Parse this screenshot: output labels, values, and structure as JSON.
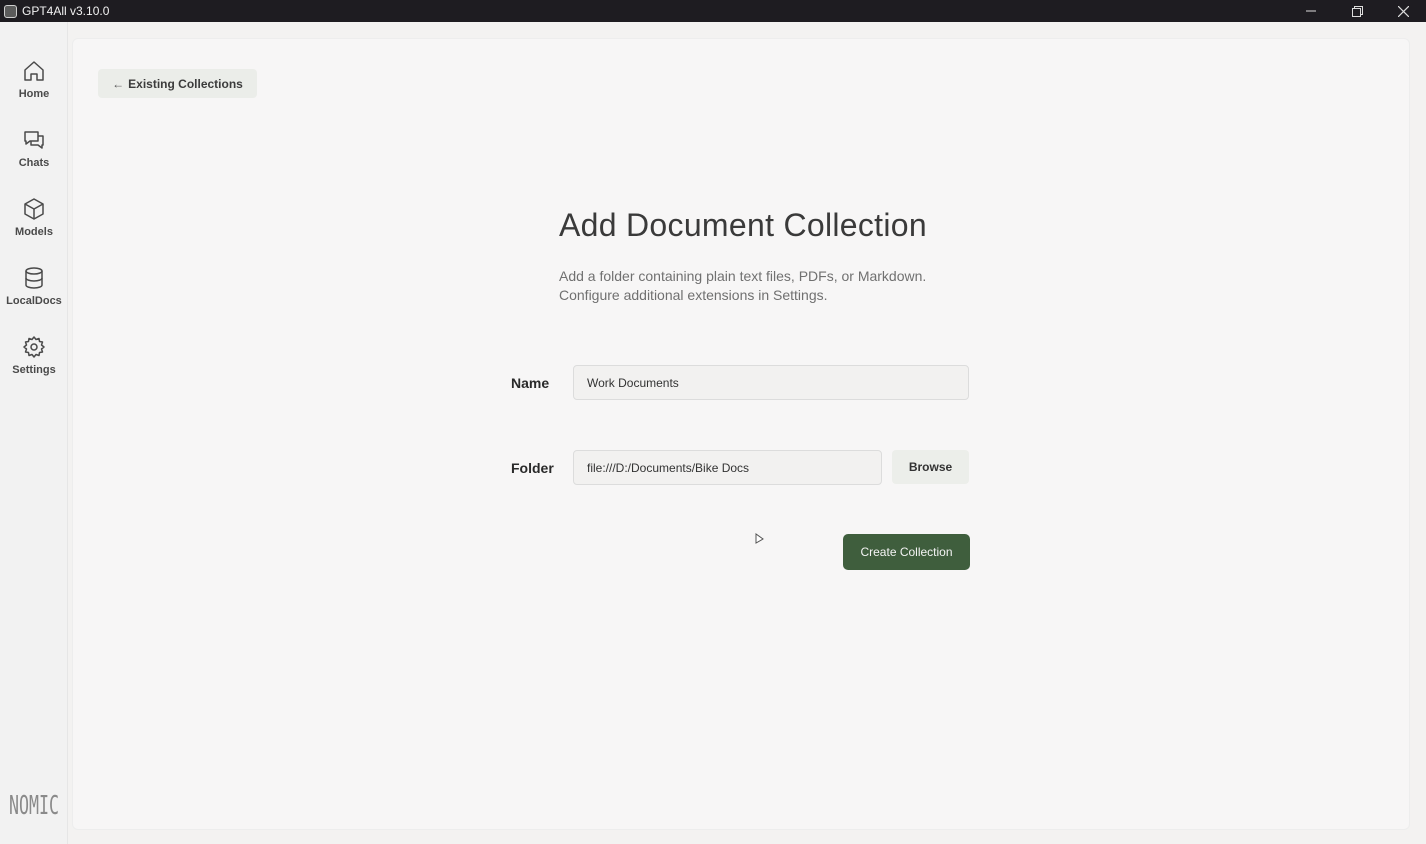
{
  "window": {
    "title": "GPT4All v3.10.0"
  },
  "sidebar": {
    "items": [
      {
        "label": "Home",
        "icon": "home-icon"
      },
      {
        "label": "Chats",
        "icon": "chat-icon"
      },
      {
        "label": "Models",
        "icon": "cube-icon"
      },
      {
        "label": "LocalDocs",
        "icon": "database-icon"
      },
      {
        "label": "Settings",
        "icon": "gear-icon"
      }
    ],
    "logo": "NOMIC"
  },
  "main": {
    "back_label": "Existing Collections",
    "back_arrow": "←",
    "heading": "Add Document Collection",
    "description_line1": "Add a folder containing plain text files, PDFs, or Markdown.",
    "description_line2": "Configure additional extensions in Settings.",
    "name_label": "Name",
    "name_value": "Work Documents",
    "folder_label": "Folder",
    "folder_value": "file:///D:/Documents/Bike Docs",
    "browse_label": "Browse",
    "create_label": "Create Collection"
  },
  "colors": {
    "accent": "#3f5e3d",
    "titlebar": "#1e1c21",
    "background": "#f7f6f6"
  }
}
